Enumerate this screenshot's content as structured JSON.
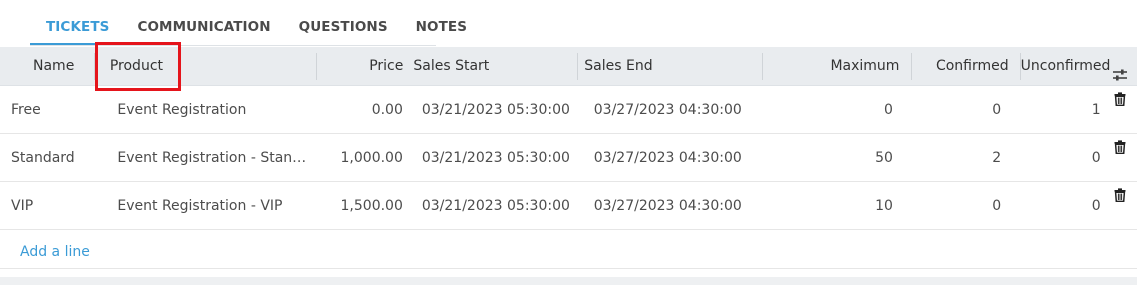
{
  "tabs": [
    {
      "label": "TICKETS",
      "active": true
    },
    {
      "label": "COMMUNICATION",
      "active": false
    },
    {
      "label": "QUESTIONS",
      "active": false
    },
    {
      "label": "NOTES",
      "active": false
    }
  ],
  "table": {
    "headers": {
      "name": "Name",
      "product": "Product",
      "price": "Price",
      "sales_start": "Sales Start",
      "sales_end": "Sales End",
      "maximum": "Maximum",
      "confirmed": "Confirmed",
      "unconfirmed": "Unconfirmed"
    },
    "rows": [
      {
        "name": "Free",
        "product": "Event Registration",
        "price": "0.00",
        "sales_start": "03/21/2023 05:30:00",
        "sales_end": "03/27/2023 04:30:00",
        "maximum": "0",
        "confirmed": "0",
        "unconfirmed": "1"
      },
      {
        "name": "Standard",
        "product": "Event Registration - Stan…",
        "price": "1,000.00",
        "sales_start": "03/21/2023 05:30:00",
        "sales_end": "03/27/2023 04:30:00",
        "maximum": "50",
        "confirmed": "2",
        "unconfirmed": "0"
      },
      {
        "name": "VIP",
        "product": "Event Registration - VIP",
        "price": "1,500.00",
        "sales_start": "03/21/2023 05:30:00",
        "sales_end": "03/27/2023 04:30:00",
        "maximum": "10",
        "confirmed": "0",
        "unconfirmed": "0"
      }
    ],
    "add_line_label": "Add a line"
  },
  "icons": {
    "delete": "trash-icon",
    "column_settings": "sliders-icon"
  },
  "colors": {
    "accent": "#3b9bd6",
    "highlight": "#e5141b",
    "header_bg": "#e9ecef"
  }
}
